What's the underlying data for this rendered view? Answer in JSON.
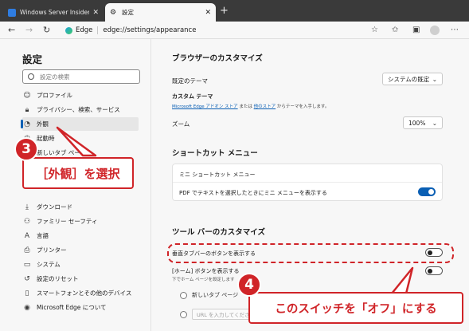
{
  "tabs": [
    {
      "title": "Windows Server Insider : 企業情",
      "active": false
    },
    {
      "title": "設定",
      "active": true
    }
  ],
  "new_tab": "+",
  "address": {
    "edge_label": "Edge",
    "url": "edge://settings/appearance"
  },
  "sidebar": {
    "title": "設定",
    "search_placeholder": "設定の検索",
    "items": [
      {
        "label": "プロファイル",
        "icon": "profile-icon"
      },
      {
        "label": "プライバシー、検索、サービス",
        "icon": "lock-icon"
      },
      {
        "label": "外観",
        "icon": "appearance-icon",
        "selected": true
      },
      {
        "label": "起動時",
        "icon": "power-icon"
      },
      {
        "label": "新しいタブ ページ",
        "icon": "newtab-icon"
      },
      {
        "label": "ダウンロード",
        "icon": "download-icon"
      },
      {
        "label": "ファミリー セーフティ",
        "icon": "family-icon"
      },
      {
        "label": "言語",
        "icon": "language-icon"
      },
      {
        "label": "プリンター",
        "icon": "printer-icon"
      },
      {
        "label": "システム",
        "icon": "system-icon"
      },
      {
        "label": "設定のリセット",
        "icon": "reset-icon"
      },
      {
        "label": "スマートフォンとその他のデバイス",
        "icon": "phone-icon"
      },
      {
        "label": "Microsoft Edge について",
        "icon": "edge-icon"
      }
    ]
  },
  "main": {
    "browser_custom_title": "ブラウザーのカスタマイズ",
    "default_theme_label": "既定のテーマ",
    "default_theme_value": "システムの既定",
    "custom_theme_label": "カスタム テーマ",
    "custom_theme_link1": "Microsoft Edge アドオン ストア",
    "custom_theme_mid": " または ",
    "custom_theme_link2": "他のストア",
    "custom_theme_tail": " からテーマを入手します。",
    "zoom_label": "ズーム",
    "zoom_value": "100%",
    "shortcut_title": "ショートカット メニュー",
    "mini_menu_label": "ミニ ショートカット メニュー",
    "mini_menu_toggle_label": "PDF でテキストを選択したときにミニ メニューを表示する",
    "mini_menu_toggle_on": true,
    "toolbar_title": "ツール バーのカスタマイズ",
    "vertical_tabs_label": "垂直タブバーのボタンを表示する",
    "vertical_tabs_on": false,
    "home_button_label": "[ホーム] ボタンを表示する",
    "home_button_sub": "下でホーム ページを設定します",
    "radio_newtab": "新しいタブ ページ",
    "radio_url": "URL を入力してください"
  },
  "annotations": {
    "step3_number": "3",
    "step3_text": "［外観］を選択",
    "step4_number": "4",
    "step4_text": "このスイッチを「オフ」にする",
    "color": "#d02428"
  }
}
